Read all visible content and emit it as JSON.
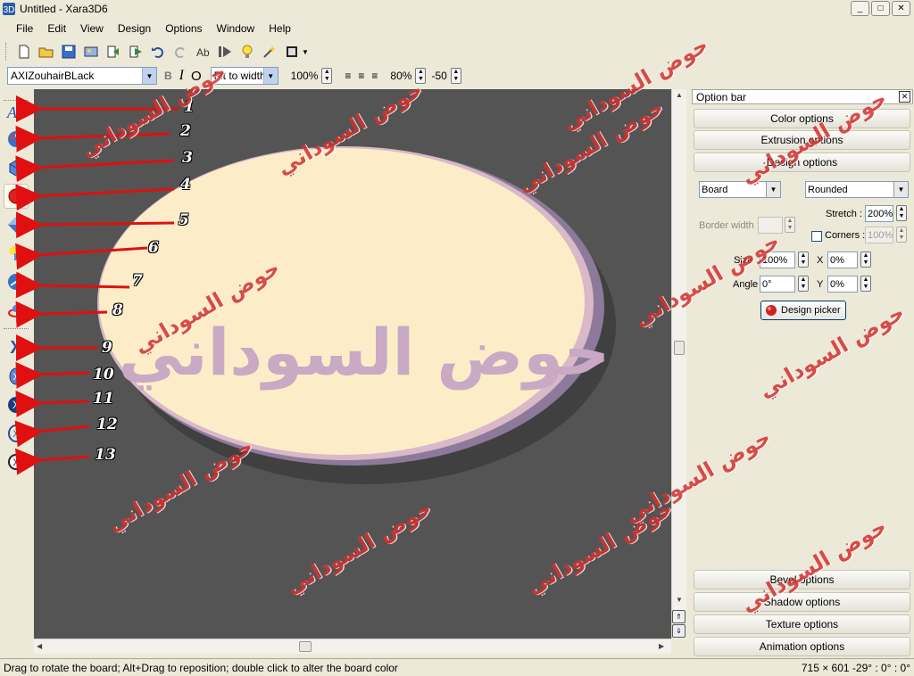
{
  "window": {
    "title": "Untitled - Xara3D6",
    "buttons": [
      "_",
      "□",
      "✕"
    ]
  },
  "menu": [
    {
      "label": "File"
    },
    {
      "label": "Edit"
    },
    {
      "label": "View"
    },
    {
      "label": "Design"
    },
    {
      "label": "Options"
    },
    {
      "label": "Window"
    },
    {
      "label": "Help"
    }
  ],
  "toolbar2": {
    "font_name": "AXIZouhairBLack",
    "fit_mode": "Fit to width",
    "zoom": "100%",
    "line_spacing": "80%",
    "char_spacing": "-50"
  },
  "canvas": {
    "board_text": "حوض السوداني",
    "board_color": "#fcedc8",
    "background": "#545454"
  },
  "annotations": [
    "1",
    "2",
    "3",
    "4",
    "5",
    "6",
    "7",
    "8",
    "9",
    "10",
    "11",
    "12",
    "13"
  ],
  "watermark": "حوض السوداني",
  "option_bar": {
    "title": "Option bar",
    "tabs_top": [
      "Color options",
      "Extrusion options",
      "Design options"
    ],
    "board_type": "Board",
    "corner_type": "Rounded",
    "border_width_label": "Border width :",
    "border_width_value": "",
    "stretch_label": "Stretch :",
    "stretch_value": "200%",
    "corners_label": "Corners :",
    "corners_value": "100%",
    "size_label": "Size",
    "size_value": "100%",
    "x_label": "X",
    "x_value": "0%",
    "angle_label": "Angle",
    "angle_value": "0°",
    "y_label": "Y",
    "y_value": "0%",
    "design_picker": "Design picker",
    "tabs_bottom": [
      "Bevel options",
      "Shadow options",
      "Texture options",
      "Animation options"
    ]
  },
  "status": {
    "hint": "Drag to rotate the board; Alt+Drag to reposition; double click to alter the board color",
    "coords": "715 × 601 -29° : 0° : 0°"
  }
}
